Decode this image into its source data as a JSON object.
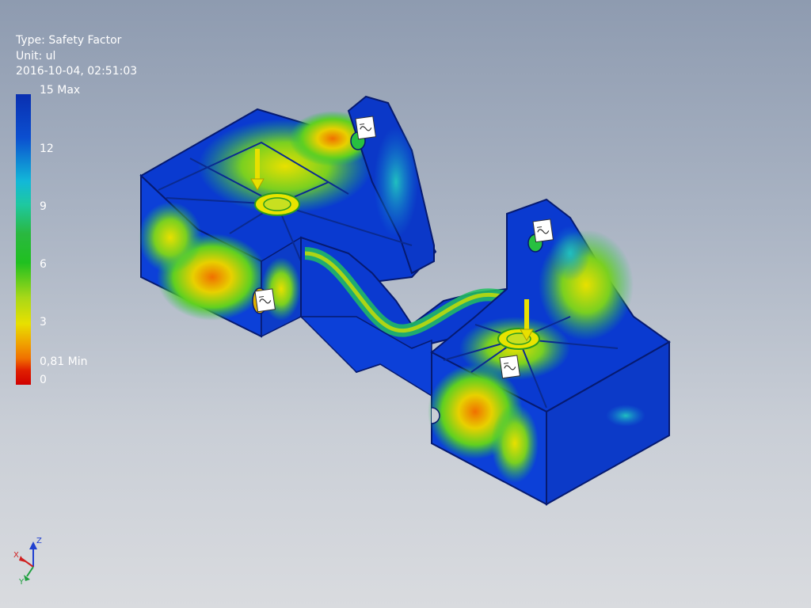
{
  "legend": {
    "type_line": "Type: Safety Factor",
    "unit_line": "Unit: ul",
    "timestamp": "2016-10-04, 02:51:03",
    "ticks": [
      "15 Max",
      "12",
      "9",
      "6",
      "3",
      "0,81 Min",
      "0"
    ]
  },
  "viewport": {
    "model": "fea-safety-factor-result-part",
    "triad_axes": [
      "X",
      "Y",
      "Z"
    ]
  },
  "colors": {
    "max_blue": "#0a2fb0",
    "mid_green": "#2ab840",
    "yellow": "#e8e000",
    "orange": "#f07000",
    "min_red": "#d00000"
  },
  "icons": [
    "load-arrow-icon",
    "constraint-icon",
    "view-triad-icon"
  ]
}
